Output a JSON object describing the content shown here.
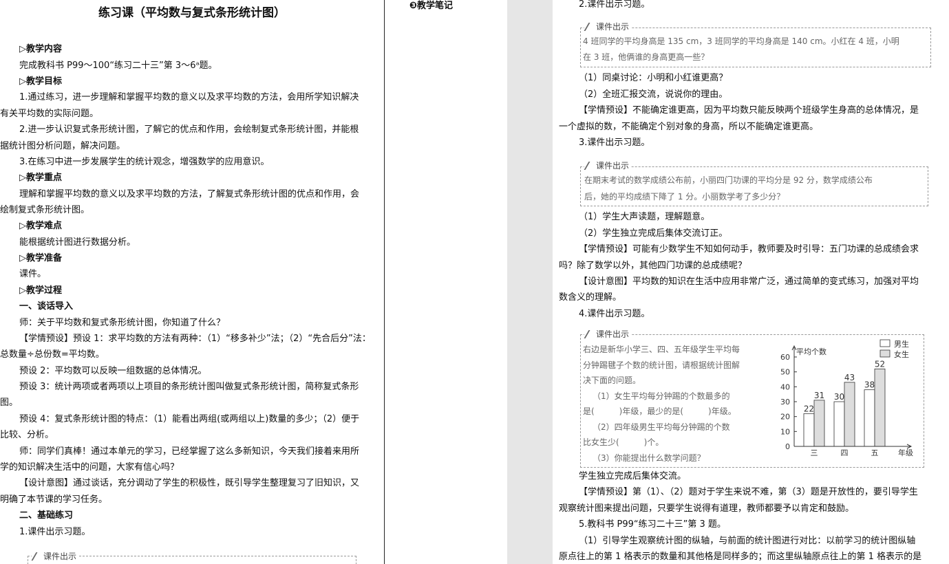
{
  "left": {
    "title": "练习课（平均数与复式条形统计图）",
    "lines": [
      "▷教学内容",
      "完成教科书 P99～100“练习二十三”第 3～6ᵃ题。",
      "▷教学目标",
      "1.通过练习，进一步理解和掌握平均数的意义以及求平均数的方法，会用所学知识解决",
      "有关平均数的实际问题。",
      "2.进一步认识复式条形统计图，了解它的优点和作用，会绘制复式条形统计图，并能根",
      "据统计图分析问题，解决问题。",
      "3.在练习中进一步发展学生的统计观念，增强数学的应用意识。",
      "▷教学重点",
      "理解和掌握平均数的意义以及求平均数的方法，了解复式条形统计图的优点和作用，会",
      "绘制复式条形统计图。",
      "▷教学难点",
      "能根据统计图进行数据分析。",
      "▷教学准备",
      "课件。",
      "▷教学过程",
      "一、谈话导入",
      "师：关于平均数和复式条形统计图，你知道了什么？",
      "【学情预设】预设 1：求平均数的方法有两种：（1）“移多补少”法；（2）“先合后分”法：",
      "总数量÷总份数=平均数。",
      "预设 2：平均数可以反映一组数据的总体情况。",
      "预设 3：统计两项或者两项以上项目的条形统计图叫做复式条形统计图，简称复式条形",
      "图。",
      "预设 4：复式条形统计图的特点：（1）能看出两组(或两组以上)数量的多少；（2）便于",
      "比较、分析。",
      "师：同学们真棒！通过本单元的学习，已经掌握了这么多新知识，今天我们接着来用所",
      "学的知识解决生活中的问题，大家有信心吗？",
      "【设计意图】通过谈话，充分调动了学生的积极性，既引导学生整理复习了旧知识，又",
      "明确了本节课的学习任务。",
      "二、基础练习",
      "1.课件出示习题。"
    ],
    "box_label": "课件出示"
  },
  "notes": {
    "title": "❸教学笔记"
  },
  "right": {
    "lines_a": [
      "2.课件出示习题。"
    ],
    "box1": {
      "label": "课件出示",
      "line1": "4 班同学的平均身高是 135 cm，3 班同学的平均身高是 140 cm。小红在 4 班，小明",
      "line2": "在 3 班，他俩谁的身高更高一些？"
    },
    "lines_b": [
      "（1）同桌讨论：小明和小红谁更高？",
      "（2）全班汇报交流，说说你的理由。",
      "【学情预设】不能确定谁更高，因为平均数只能反映两个班级学生身高的总体情况，是",
      "一个虚拟的数，不能确定个别对象的身高，所以不能确定谁更高。",
      "3.课件出示习题。"
    ],
    "box2": {
      "label": "课件出示",
      "line1": "在期末考试的数学成绩公布前，小丽四门功课的平均分是 92 分，数学成绩公布",
      "line2": "后，她的平均成绩下降了 1 分。小丽数学考了多少分？"
    },
    "lines_c": [
      "（1）学生大声读题，理解题意。",
      "（2）学生独立完成后集体交流订正。",
      "【学情预设】可能有少数学生不知如何动手，教师要及时引导：五门功课的总成绩会求",
      "吗？除了数学以外，其他四门功课的总成绩呢？",
      "【设计意图】平均数的知识在生活中应用非常广泛，通过简单的变式练习，加强对平均",
      "数含义的理解。",
      "4.课件出示习题。"
    ],
    "box3": {
      "label": "课件出示",
      "text": [
        "右边是新华小学三、四、五年级学生平均每",
        "分钟踢毽子个数的统计图，请根据统计图解",
        "决下面的问题。",
        "（1）女生平均每分钟踢的个数最多的",
        "是(　　　)年级，最少的是(　　　)年级。",
        "（2）四年级男生平均每分钟踢的个数",
        "比女生少(　　　)个。",
        "（3）你能提出什么数学问题？"
      ]
    },
    "lines_d": [
      "学生独立完成后集体交流。",
      "【学情预设】第（1）、（2）题对于学生来说不难，第（3）题是开放性的，要引导学生",
      "观察统计图来提出问题，只要学生说得有道理，教师都要予以肯定和鼓励。",
      "5.教科书 P99“练习二十三”第 3 题。",
      "（1）引导学生观察统计图的纵轴，与前面的统计图进行对比：以前学习的统计图纵轴",
      "原点往上的第 1 格表示的数量和其他格是同样多的；而这里纵轴原点往上的第 1 格表示的是"
    ]
  },
  "chart_data": {
    "type": "bar",
    "categories": [
      "三",
      "四",
      "五"
    ],
    "series": [
      {
        "name": "男生",
        "values": [
          22,
          30,
          38
        ],
        "color": "#ffffff"
      },
      {
        "name": "女生",
        "values": [
          31,
          43,
          52
        ],
        "color": "#dddddd"
      }
    ],
    "ylabel": "平均个数",
    "xlabel": "年级",
    "ylim": [
      0,
      60
    ],
    "yticks": [
      0,
      10,
      20,
      30,
      40,
      50,
      60
    ],
    "legend": "top-right"
  }
}
